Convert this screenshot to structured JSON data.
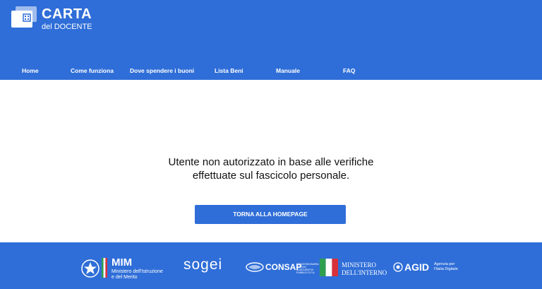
{
  "brand": {
    "title": "CARTA",
    "subtitle": "del DOCENTE"
  },
  "nav": {
    "items": [
      "Home",
      "Come funziona",
      "Dove spendere i buoni",
      "Lista Beni",
      "Manuale",
      "FAQ"
    ]
  },
  "main": {
    "message_line1": "Utente non autorizzato in base alle verifiche",
    "message_line2": "effettuate sul fascicolo personale.",
    "button_label": "TORNA ALLA HOMEPAGE"
  },
  "footer": {
    "mim_title": "MIM",
    "mim_subtitle_line1": "Ministero dell'Istruzione",
    "mim_subtitle_line2": "e del Merito",
    "sogei": "sogei",
    "consap": "CONSAP",
    "consap_small": "CONCESSIONARIA SERVIZI ASSICURATIVI PUBBLICI S.P.A.",
    "ministero_line1": "MINISTERO",
    "ministero_line2": "DELL'INTERNO",
    "agid": "AGID",
    "agid_sub_line1": "Agenzia per",
    "agid_sub_line2": "l'Italia Digitale"
  },
  "colors": {
    "brand_blue": "#2f6ed8",
    "white": "#ffffff",
    "text_dark": "#111111"
  },
  "icons": [
    "card-qr-icon",
    "mim-emblem-icon",
    "italy-flag-icon",
    "consap-logo-icon",
    "ministero-flag-icon",
    "agid-logo-icon"
  ]
}
